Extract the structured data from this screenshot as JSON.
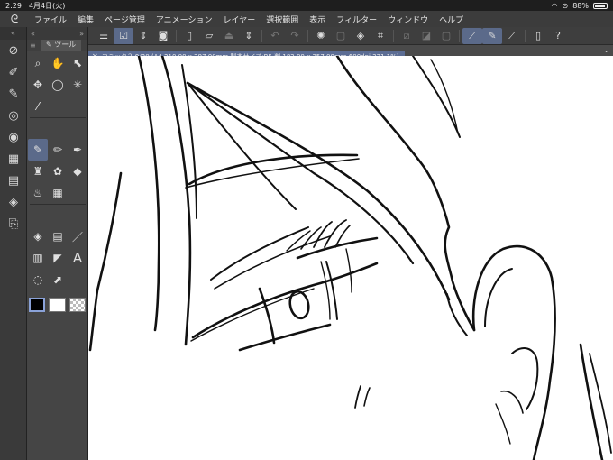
{
  "status": {
    "time": "2:29",
    "date": "4月4日(火)",
    "battery": "88%",
    "battery_level": 0.88
  },
  "menubar": {
    "items": [
      "ファイル",
      "編集",
      "ページ管理",
      "アニメーション",
      "レイヤー",
      "選択範囲",
      "表示",
      "フィルター",
      "ウィンドウ",
      "ヘルプ"
    ]
  },
  "tool_panel": {
    "tab_label": "ツール",
    "tools": [
      {
        "name": "zoom-tool-icon",
        "glyph": "🔍"
      },
      {
        "name": "hand-tool-icon",
        "glyph": "✋"
      },
      {
        "name": "select-object-tool-icon",
        "glyph": "⬉"
      },
      {
        "name": "move-tool-icon",
        "glyph": "✥"
      },
      {
        "name": "lasso-tool-icon",
        "glyph": "◯"
      },
      {
        "name": "magic-wand-tool-icon",
        "glyph": "✳"
      },
      {
        "name": "eyedropper-tool-icon",
        "glyph": "⁄"
      },
      {
        "name": "pen-tool-icon",
        "glyph": "✎"
      },
      {
        "name": "pencil-tool-icon",
        "glyph": "✏"
      },
      {
        "name": "brush-tool-icon",
        "glyph": "✒"
      },
      {
        "name": "airbrush-tool-icon",
        "glyph": "🖌"
      },
      {
        "name": "decoration-tool-icon",
        "glyph": "✿"
      },
      {
        "name": "eraser-tool-icon",
        "glyph": "◆"
      },
      {
        "name": "blend-tool-icon",
        "glyph": "💧"
      },
      {
        "name": "frame-tool-icon",
        "glyph": "▦"
      },
      {
        "name": "fill-tool-icon",
        "glyph": "◈"
      },
      {
        "name": "gradient-tool-icon",
        "glyph": "▤"
      },
      {
        "name": "line-tool-icon",
        "glyph": "／"
      },
      {
        "name": "ruler-tool-icon",
        "glyph": "▥"
      },
      {
        "name": "figure-tool-icon",
        "glyph": "◤"
      },
      {
        "name": "text-tool-icon",
        "glyph": "A"
      },
      {
        "name": "balloon-tool-icon",
        "glyph": "💬"
      },
      {
        "name": "correct-line-tool-icon",
        "glyph": "⬈"
      }
    ]
  },
  "command_bar": {
    "buttons": [
      {
        "name": "menu-icon",
        "glyph": "☰"
      },
      {
        "name": "layer-view-icon",
        "glyph": "☑",
        "active": true
      },
      {
        "name": "updown-icon",
        "glyph": "⇕"
      },
      {
        "name": "camera-icon",
        "glyph": "📷"
      },
      {
        "name": "new-icon",
        "glyph": "🗋"
      },
      {
        "name": "open-icon",
        "glyph": "📂"
      },
      {
        "name": "save-icon",
        "glyph": "⏏"
      },
      {
        "name": "updown2-icon",
        "glyph": "⇕"
      },
      {
        "name": "undo-icon",
        "glyph": "↶"
      },
      {
        "name": "redo-icon",
        "glyph": "↷"
      },
      {
        "name": "spinner-icon",
        "glyph": "✺"
      },
      {
        "name": "clear-icon",
        "glyph": "▢",
        "dim": true
      },
      {
        "name": "fill-icon",
        "glyph": "◈"
      },
      {
        "name": "crop-icon",
        "glyph": "⌗"
      },
      {
        "name": "transform-icon",
        "glyph": "⧄",
        "dim": true
      },
      {
        "name": "tone-icon",
        "glyph": "◪",
        "dim": true
      },
      {
        "name": "square-icon",
        "glyph": "▢",
        "dim": true
      },
      {
        "name": "ruler-snap-icon",
        "glyph": "⟋",
        "active": true
      },
      {
        "name": "brush-snap-icon",
        "glyph": "✎",
        "active": true
      },
      {
        "name": "special-ruler-icon",
        "glyph": "⟋"
      },
      {
        "name": "smartphone-icon",
        "glyph": "▯"
      },
      {
        "name": "help-icon",
        "glyph": "?"
      }
    ]
  },
  "document": {
    "tab_label": "コミック２ 9/20 (A4 210.00 x 297.00mm 製本サイズ:B5 判 182.00 x 257.00mm 600dpi 221.1%)"
  }
}
